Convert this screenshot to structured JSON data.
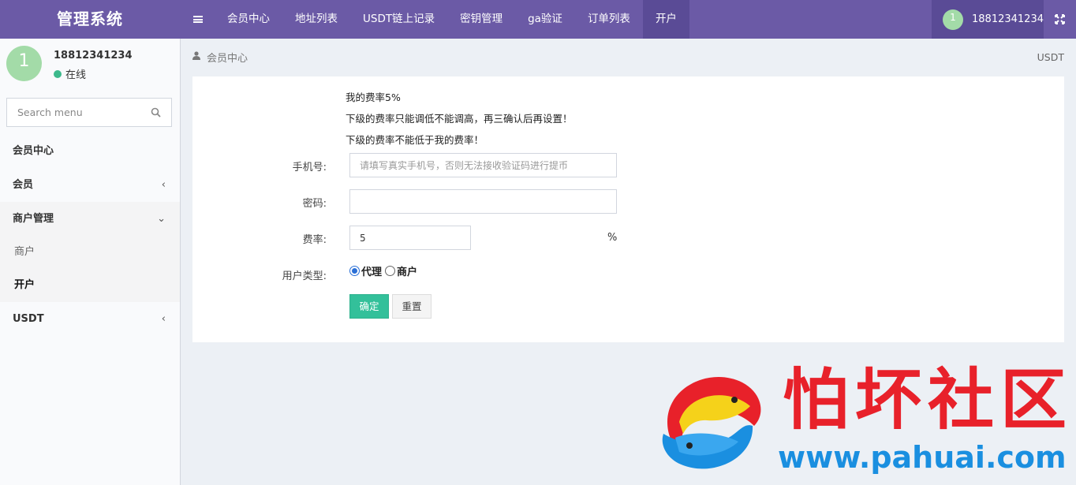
{
  "header": {
    "logo": "管理系统",
    "nav": [
      {
        "label": "会员中心"
      },
      {
        "label": "地址列表"
      },
      {
        "label": "USDT链上记录"
      },
      {
        "label": "密钥管理"
      },
      {
        "label": "ga验证"
      },
      {
        "label": "订单列表"
      },
      {
        "label": "开户",
        "active": true
      }
    ],
    "user": {
      "avatar": "1",
      "phone": "18812341234"
    },
    "icons": {
      "menu": "hamburger-icon",
      "fullscreen": "expand-icon"
    }
  },
  "sidebar": {
    "avatar": "1",
    "phone": "18812341234",
    "status": "在线",
    "search_placeholder": "Search menu",
    "menu": {
      "member_center": "会员中心",
      "member": "会员",
      "merchant_mgmt": "商户管理",
      "merchant": "商户",
      "open_account": "开户",
      "usdt": "USDT"
    }
  },
  "breadcrumb": {
    "current": "会员中心",
    "right": "USDT"
  },
  "form": {
    "info_lines": [
      "我的费率5%",
      "下级的费率只能调低不能调高，再三确认后再设置！",
      "下级的费率不能低于我的费率！"
    ],
    "phone_label": "手机号:",
    "phone_placeholder": "请填写真实手机号，否则无法接收验证码进行提币",
    "password_label": "密码:",
    "password_value": "",
    "rate_label": "费率:",
    "rate_value": "5",
    "rate_unit": "%",
    "user_type_label": "用户类型:",
    "user_types": [
      {
        "label": "代理",
        "checked": true
      },
      {
        "label": "商户",
        "checked": false
      }
    ],
    "submit": "确定",
    "reset": "重置"
  },
  "watermark": {
    "title": "怕坏社区",
    "url": "www.pahuai.com"
  },
  "colors": {
    "header": "#6b5aa6",
    "header_active": "#5a4b96",
    "primary_button": "#33c09a",
    "online": "#3cb98c",
    "avatar": "#a3dba8",
    "watermark_red": "#e8212a",
    "watermark_blue": "#1a8fe0"
  }
}
